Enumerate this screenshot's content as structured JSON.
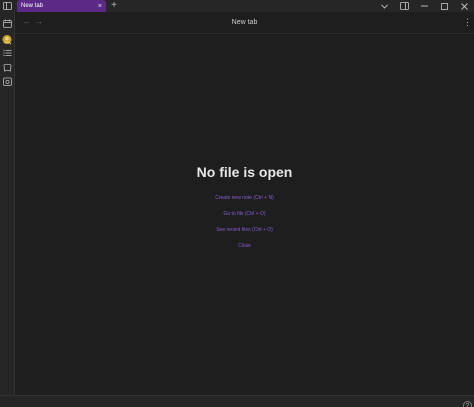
{
  "tabbar": {
    "active_tab_label": "New tab",
    "close_glyph": "×",
    "new_tab_glyph": "+"
  },
  "header": {
    "title": "New tab",
    "back_glyph": "←",
    "forward_glyph": "→",
    "more_glyph": "⋮"
  },
  "empty_state": {
    "title": "No file is open",
    "actions": [
      {
        "label": "Create new note (Ctrl + N)"
      },
      {
        "label": "Go to file (Ctrl + O)"
      },
      {
        "label": "See recent files (Ctrl + O)"
      },
      {
        "label": "Close"
      }
    ]
  },
  "colors": {
    "accent": "#8a5cd6",
    "tab_active": "#5b2a86",
    "background": "#1e1e1e",
    "chrome": "#262626"
  },
  "icons": {
    "ribbon_top": "sidebar-toggle-icon",
    "ribbon": [
      "calendar-icon",
      "avatar-icon",
      "list-icon",
      "canvas-icon",
      "daily-note-icon"
    ],
    "window": [
      "chevron-down-icon",
      "sidebar-right-icon",
      "minimize-icon",
      "maximize-icon",
      "close-icon"
    ],
    "status": "help-icon"
  }
}
